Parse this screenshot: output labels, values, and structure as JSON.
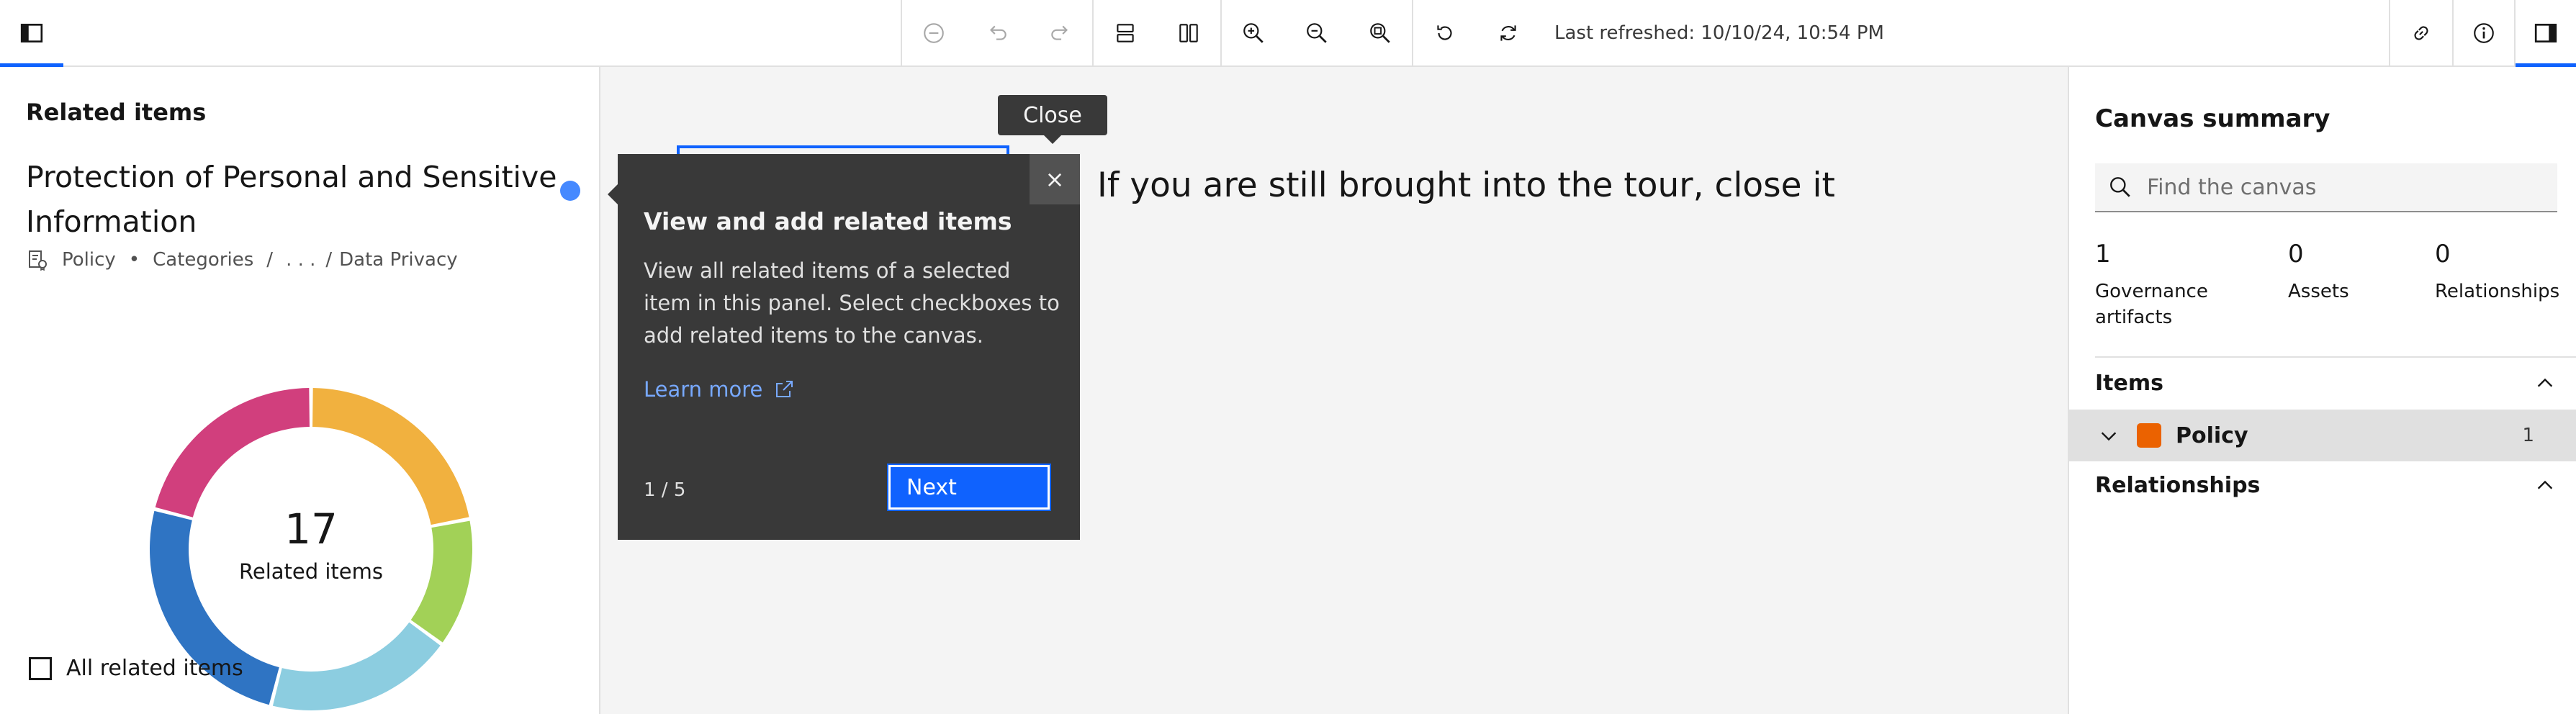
{
  "toolbar": {
    "icons": [
      "left-panel-toggle-icon",
      "clear-icon",
      "undo-icon",
      "redo-icon",
      "layout-vertical-icon",
      "layout-columns-icon",
      "zoom-in-icon",
      "zoom-out-icon",
      "zoom-fit-icon",
      "reset-icon",
      "refresh-icon",
      "link-icon",
      "info-icon",
      "right-panel-toggle-icon"
    ],
    "last_refreshed": "Last refreshed: 10/10/24, 10:54 PM"
  },
  "left_panel": {
    "heading": "Related items",
    "item_title": "Protection of Personal and Sensitive Information",
    "breadcrumb": {
      "type": "Policy",
      "sep1": "•",
      "level1": "Categories",
      "sep2": "/",
      "ellipsis": ". . .",
      "sep3": "/",
      "level2": "Data Privacy"
    },
    "donut": {
      "count": "17",
      "label": "Related items",
      "segments": [
        {
          "color": "#f1b13f",
          "share": 0.22
        },
        {
          "color": "#a2d157",
          "share": 0.13
        },
        {
          "color": "#8ccde0",
          "share": 0.19
        },
        {
          "color": "#2f74c3",
          "share": 0.25
        },
        {
          "color": "#d13f7d",
          "share": 0.21
        }
      ]
    },
    "checkbox_label": "All related items"
  },
  "canvas": {
    "node_text": "If you are still brought into the tour, close it"
  },
  "tooltip": {
    "text": "Close"
  },
  "tour": {
    "title": "View and add related items",
    "body": "View all related items of a selected item in this panel. Select checkboxes to add related items to the canvas.",
    "learn_more": "Learn more",
    "step": "1 / 5",
    "next_label": "Next",
    "close_symbol": "×"
  },
  "right_panel": {
    "heading": "Canvas summary",
    "search_placeholder": "Find the canvas",
    "stats": [
      {
        "value": "1",
        "label": "Governance artifacts"
      },
      {
        "value": "0",
        "label": "Assets"
      },
      {
        "value": "0",
        "label": "Relationships"
      }
    ],
    "items_heading": "Items",
    "policy_label": "Policy",
    "policy_count": "1",
    "relationships_heading": "Relationships"
  },
  "colors": {
    "accent": "#0f62fe",
    "policy": "#eb6200",
    "popover_bg": "#393939"
  }
}
